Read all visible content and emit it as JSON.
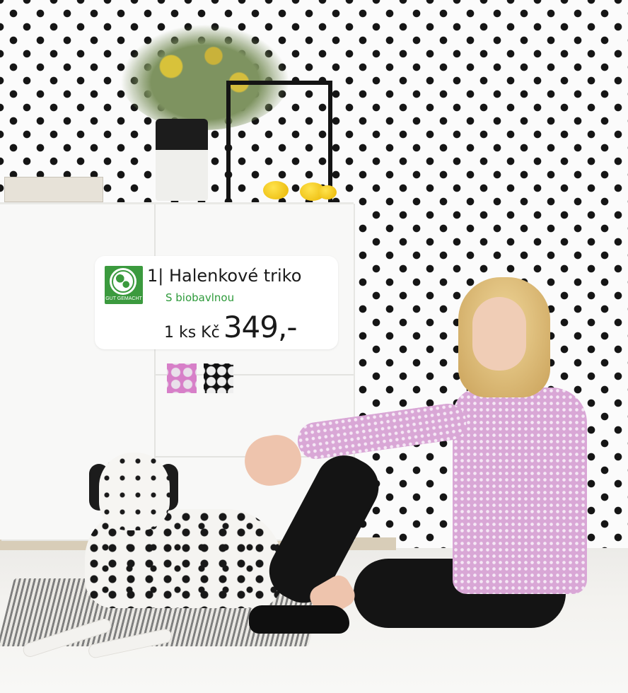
{
  "product": {
    "badge_text": "GUT GEMACHT",
    "title": "1| Halenkové triko",
    "subtitle": "S biobavlnou",
    "price_unit": "1 ks Kč",
    "price_value": "349,-"
  },
  "swatches": [
    {
      "name": "pink dotted",
      "color": "#d77fc8"
    },
    {
      "name": "black dotted",
      "color": "#111111"
    }
  ],
  "colors": {
    "badge_green": "#3b9a3e",
    "subtitle_green": "#2d9a3a",
    "card_bg": "#ffffff"
  }
}
